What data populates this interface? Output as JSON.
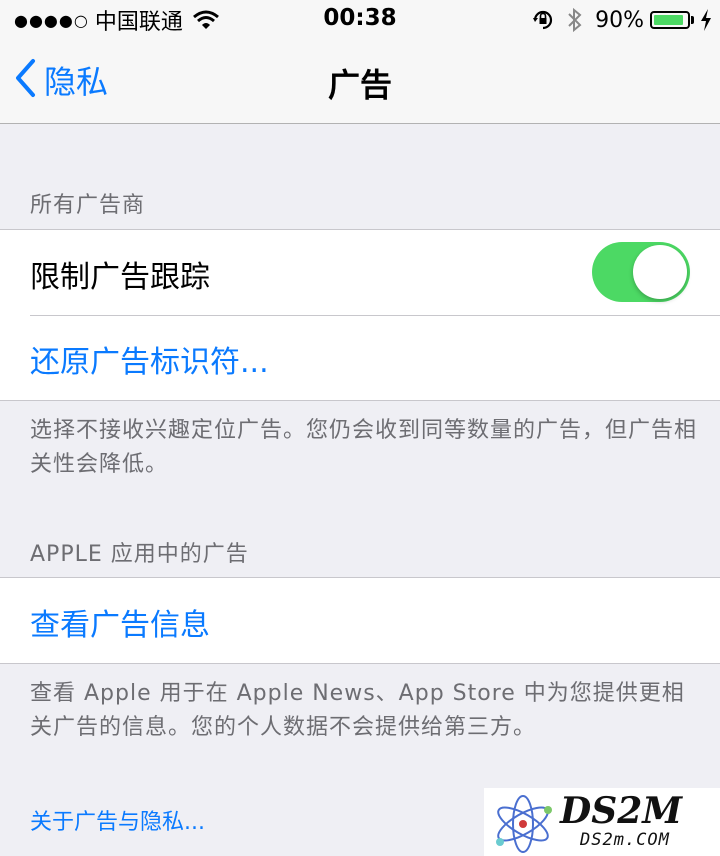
{
  "status_bar": {
    "signal": "●●●●○",
    "carrier": "中国联通",
    "time": "00:38",
    "battery_percent": "90%",
    "battery_level": 0.9,
    "icons": [
      "wifi-icon",
      "orientation-lock-icon",
      "bluetooth-icon",
      "battery-icon",
      "charging-bolt-icon"
    ]
  },
  "nav": {
    "back_label": "隐私",
    "title": "广告"
  },
  "sections": {
    "all_advertisers_header": "所有广告商",
    "limit_tracking_label": "限制广告跟踪",
    "limit_tracking_on": true,
    "reset_identifier_label": "还原广告标识符...",
    "all_advertisers_footer": "选择不接收兴趣定位广告。您仍会收到同等数量的广告，但广告相关性会降低。",
    "apple_header": "APPLE 应用中的广告",
    "view_ad_info_label": "查看广告信息",
    "apple_footer": "查看 Apple 用于在 Apple News、App Store 中为您提供更相关广告的信息。您的个人数据不会提供给第三方。",
    "about_link": "关于广告与隐私..."
  },
  "watermark": {
    "big": "DS2M",
    "small": "DS2m.COM"
  },
  "colors": {
    "accent": "#0a7aff",
    "toggle_on": "#4cd964",
    "background": "#efeff4"
  }
}
